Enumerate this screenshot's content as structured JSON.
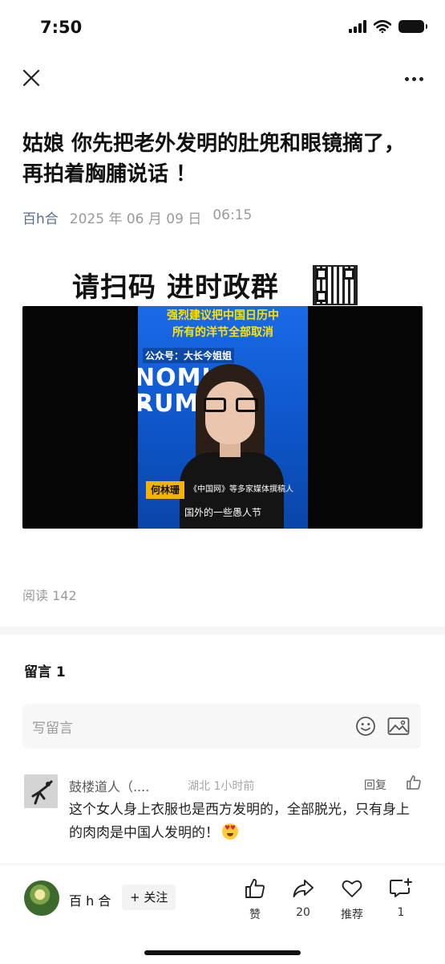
{
  "status_bar": {
    "time": "7:50"
  },
  "nav": {
    "close_icon": "close-icon",
    "more_icon": "more-icon"
  },
  "article": {
    "title": "姑娘 你先把老外发明的肚兜和眼镜摘了，再拍着胸脯说话 ！",
    "author": "百h合",
    "date": "2025 年 06 月 09 日",
    "time": "06:15"
  },
  "banner": {
    "text": "请扫码 进时政群"
  },
  "video": {
    "caption_top": "强烈建议把中国日历中\n所有的洋节全部取消",
    "watermark": "公众号：大长今姐姐",
    "background_text": "NOMIC\nRUM",
    "name_tag": "何林珊",
    "title_tag": "《中国网》等多家媒体撰稿人",
    "subtitle": "国外的一些愚人节"
  },
  "reads": "阅读 142",
  "comments": {
    "title": "留言 1",
    "placeholder": "写留言",
    "items": [
      {
        "name": "鼓楼道人（....",
        "location_time": "湖北 1小时前",
        "reply": "回复",
        "text": "这个女人身上衣服也是西方发明的，全部脱光，只有身上的肉肉是中国人发明的！"
      }
    ]
  },
  "bottom_bar": {
    "author": "百 h 合",
    "follow": "+ 关注",
    "like_label": "赞",
    "share_count": "20",
    "recommend_label": "推荐",
    "comment_count": "1"
  },
  "colors": {
    "author_link": "#576b95",
    "muted": "#9a9a9a",
    "video_blue": "#1a6ae8",
    "caption_yellow": "#ffe300"
  }
}
